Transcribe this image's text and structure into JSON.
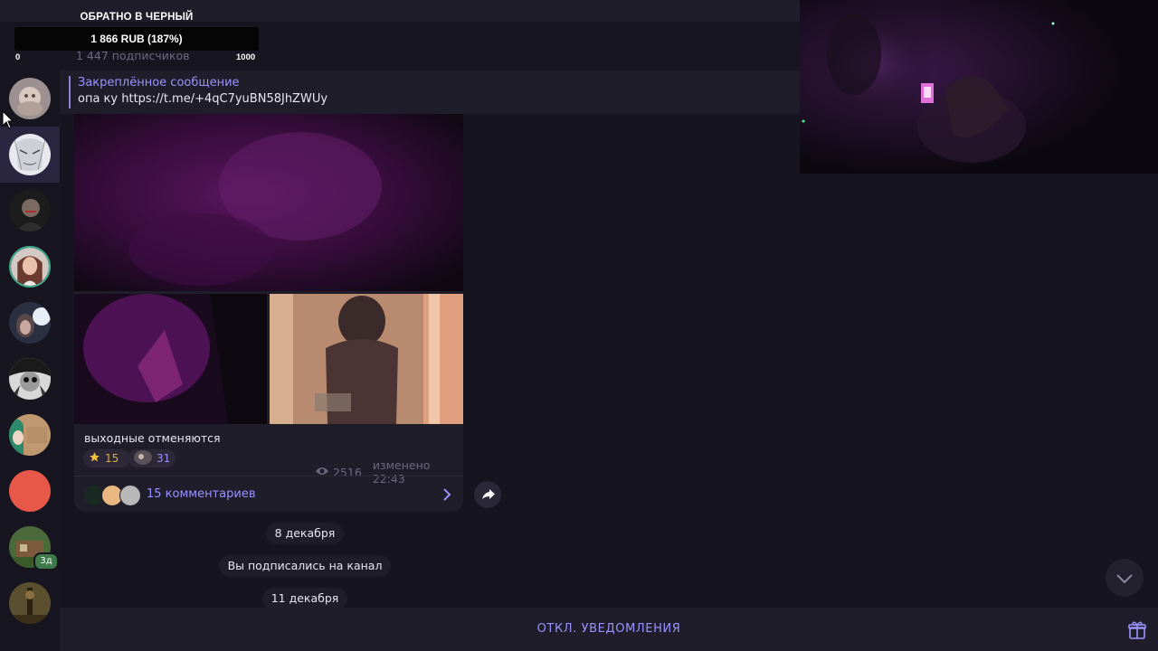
{
  "goal": {
    "title": "ОБРАТНО В ЧЕРНЫЙ",
    "amount": "1 866 RUB (187%)",
    "min": "0",
    "max": "1000",
    "progress_fraction": 1.0
  },
  "header": {
    "subscribers": "1 447 подписчиков"
  },
  "pinned": {
    "title": "Закреплённое сообщение",
    "text": "опа ку https://t.me/+4qC7yuBN58JhZWUy"
  },
  "sidebar": {
    "items": [
      {
        "name": "chat-1",
        "color": "#b7a8a8"
      },
      {
        "name": "chat-2",
        "color": "#d8d8e0"
      },
      {
        "name": "chat-3",
        "color": "#2a2a2a"
      },
      {
        "name": "chat-4",
        "color": "#6b4a44"
      },
      {
        "name": "chat-5",
        "color": "#3d4660"
      },
      {
        "name": "chat-6",
        "color": "#6a6a6a"
      },
      {
        "name": "chat-7",
        "color": "#b68a5a"
      },
      {
        "name": "chat-8",
        "color": "#e8584a"
      },
      {
        "name": "chat-9",
        "color": "#5a7a4a",
        "badge": "3д"
      },
      {
        "name": "chat-10",
        "color": "#4a4028"
      }
    ]
  },
  "message": {
    "text": "выходные отменяются",
    "reactions": [
      {
        "icon": "star-icon",
        "count": "15"
      },
      {
        "icon": "custom-emoji",
        "count": "31"
      }
    ],
    "views": "2516",
    "edited": "изменено 22:43",
    "comments_label": "15 комментариев"
  },
  "timeline": {
    "date_1": "8 декабря",
    "service": "Вы подписались на канал",
    "date_2": "11 декабря"
  },
  "bottom": {
    "mute_label": "ОТКЛ. УВЕДОМЛЕНИЯ"
  },
  "colors": {
    "accent": "#9b92ff",
    "background": "#16141f",
    "panel": "#1f1d2a"
  }
}
